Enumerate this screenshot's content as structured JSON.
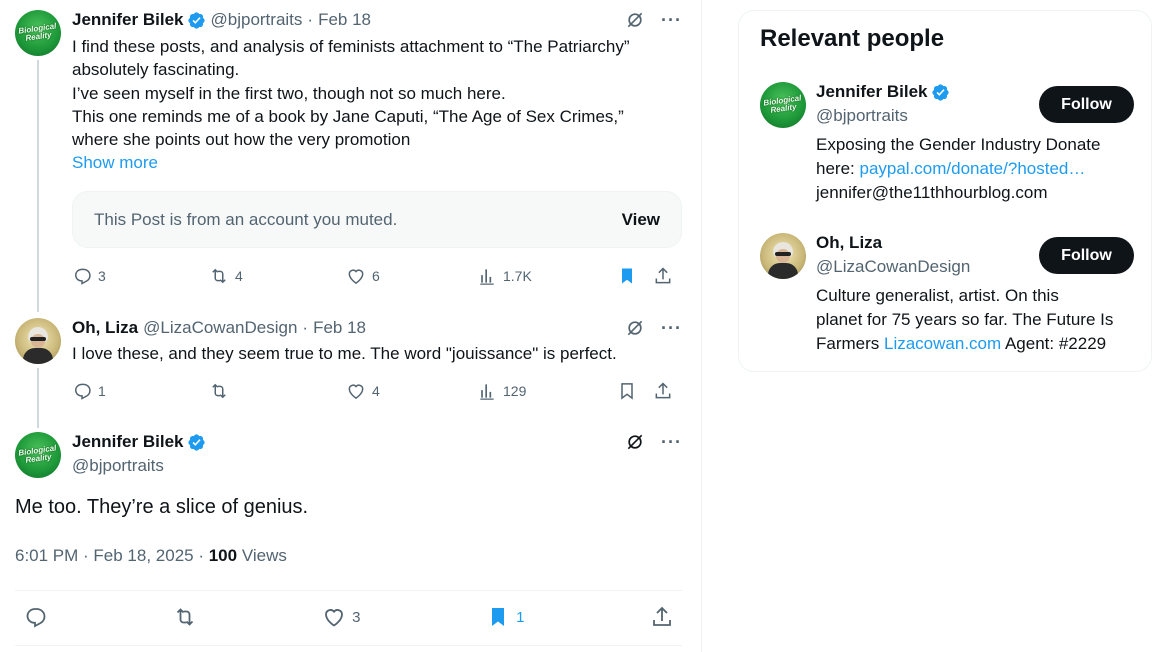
{
  "thread": [
    {
      "name": "Jennifer Bilek",
      "handle": "@bjportraits",
      "separator": "·",
      "date": "Feb 18",
      "avatar_text": "Biological Reality",
      "lines": [
        "I find these posts, and analysis of feminists attachment to “The Patriarchy”",
        "absolutely fascinating.",
        "I’ve seen myself in the first two, though not so much here.",
        "This one reminds me of a book by Jane Caputi, “The Age of Sex Crimes,”",
        "where she points out how the very promotion"
      ],
      "show_more": "Show more",
      "muted_notice": "This Post is from an account you muted.",
      "muted_view": "View",
      "replies": "3",
      "reposts": "4",
      "likes": "6",
      "views": "1.7K"
    },
    {
      "name": "Oh, Liza",
      "handle": "@LizaCowanDesign",
      "separator": "·",
      "date": "Feb 18",
      "text": "I love these, and they seem true to me. The word \"jouissance\" is perfect.",
      "replies": "1",
      "reposts": "",
      "likes": "4",
      "views": "129"
    }
  ],
  "focal": {
    "name": "Jennifer Bilek",
    "handle": "@bjportraits",
    "avatar_text": "Biological Reality",
    "text": "Me too. They’re a slice of genius.",
    "time": "6:01 PM · Feb 18, 2025 · ",
    "views_count": "100",
    "views_label": " Views",
    "likes": "3",
    "bookmarks": "1"
  },
  "relevant_people": {
    "title": "Relevant people",
    "people": [
      {
        "name": "Jennifer Bilek",
        "handle": "@bjportraits",
        "follow_label": "Follow",
        "bio_1": "Exposing the Gender Industry Donate",
        "bio_2": "here: ",
        "bio_link": "paypal.com/donate/?hosted…",
        "bio_3": "jennifer@the11thhourblog.com"
      },
      {
        "name": "Oh, Liza",
        "handle": "@LizaCowanDesign",
        "follow_label": "Follow",
        "bio_1": "Culture generalist, artist. On this",
        "bio_2": "planet for 75 years so far. The Future Is",
        "bio_3": "Farmers ",
        "bio_link": "Lizacowan.com",
        "bio_4": " Agent: #2229"
      }
    ]
  },
  "colors": {
    "accent": "#1d9bf0",
    "text": "#0f1419",
    "muted_text": "#536471",
    "follow_bg": "#0f1419"
  },
  "icons": [
    "verified-badge-icon",
    "grok-icon",
    "more-icon",
    "reply-icon",
    "repost-icon",
    "like-icon",
    "views-icon",
    "bookmark-icon",
    "share-icon"
  ]
}
